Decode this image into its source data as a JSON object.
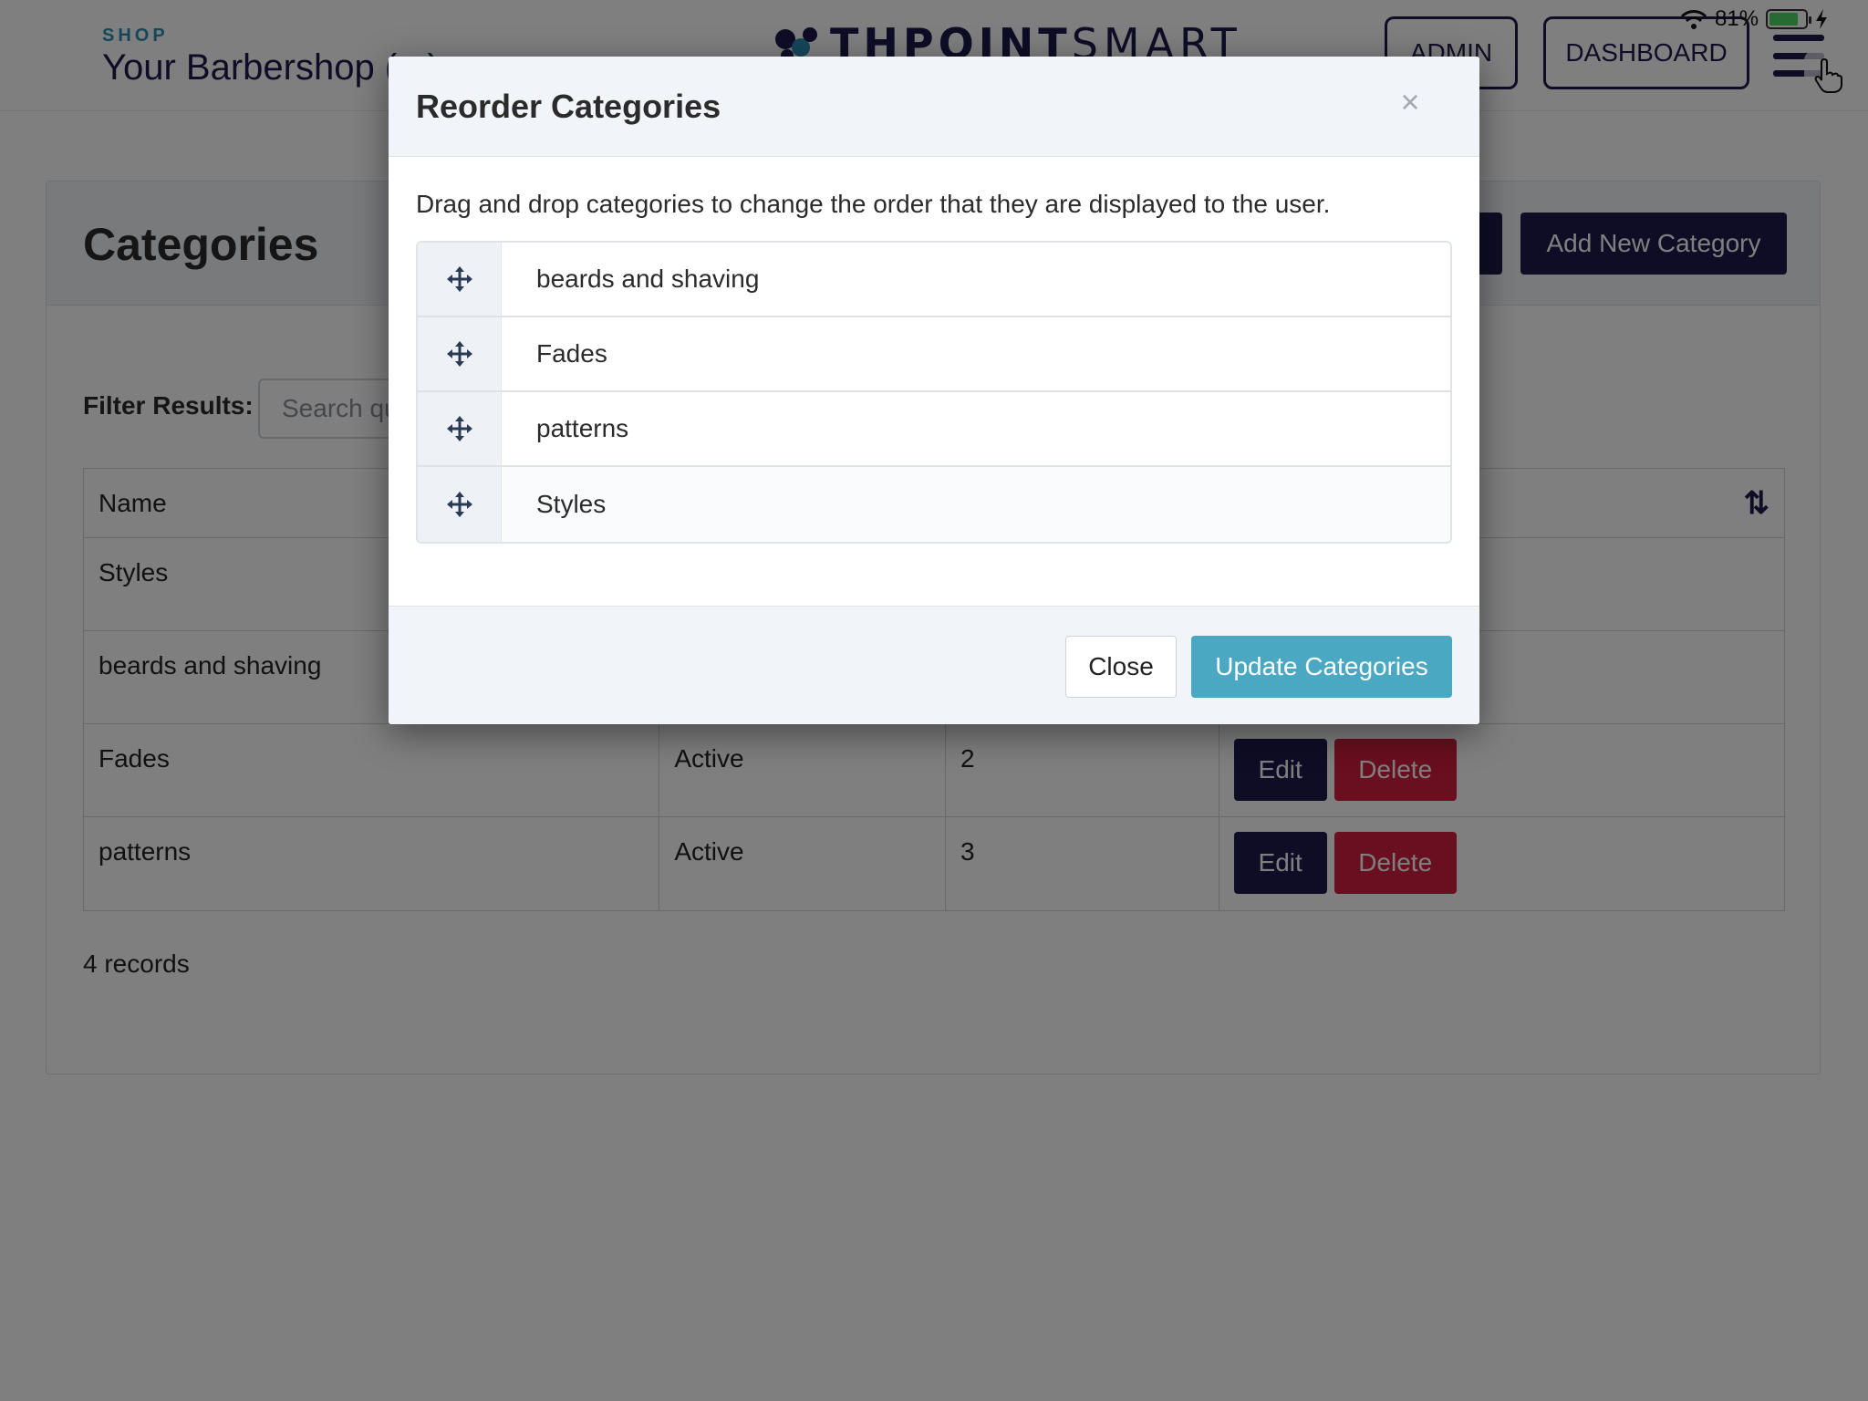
{
  "status_bar": {
    "battery": "81%"
  },
  "header": {
    "kicker": "SHOP",
    "shop_name": "Your Barbershop (...)",
    "brand_bold": "THPOINT",
    "brand_light": "SMART",
    "admin_label": "ADMIN",
    "dashboard_label": "DASHBOARD"
  },
  "page": {
    "title": "Categories",
    "add_label": "Add New Category",
    "filter_label": "Filter Results:",
    "search_placeholder": "Search qu",
    "table": {
      "columns": [
        "Name",
        "",
        "",
        ""
      ],
      "rows": [
        {
          "name": "Styles",
          "status": "",
          "order": ""
        },
        {
          "name": "beards and shaving",
          "status": "",
          "order": ""
        },
        {
          "name": "Fades",
          "status": "Active",
          "order": "2"
        },
        {
          "name": "patterns",
          "status": "Active",
          "order": "3"
        }
      ],
      "edit_label": "Edit",
      "delete_label": "Delete"
    },
    "records": "4 records"
  },
  "modal": {
    "title": "Reorder Categories",
    "close_x": "×",
    "description": "Drag and drop categories to change the order that they are displayed to the user.",
    "items": [
      {
        "label": "beards and shaving"
      },
      {
        "label": "Fades"
      },
      {
        "label": "patterns"
      },
      {
        "label": "Styles"
      }
    ],
    "close_label": "Close",
    "update_label": "Update Categories"
  },
  "colors": {
    "primary": "#1f1b4d",
    "accent": "#4aa8c2",
    "danger": "#d21e3f",
    "link": "#2a8fb5"
  },
  "icons": {
    "drag": "move-icon",
    "sort": "sort-icon",
    "menu": "hamburger-icon",
    "wifi": "wifi-icon",
    "battery": "battery-icon"
  }
}
